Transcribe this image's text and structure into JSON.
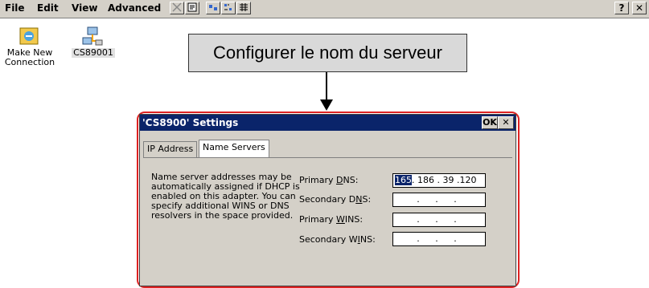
{
  "menubar": {
    "items": [
      "File",
      "Edit",
      "View",
      "Advanced"
    ],
    "help_label": "?",
    "close_label": "✕"
  },
  "desktop": {
    "icons": [
      {
        "label_line1": "Make New",
        "label_line2": "Connection",
        "icon": "make-new-connection-icon"
      },
      {
        "label_line1": "CS89001",
        "label_line2": "",
        "icon": "network-connection-icon"
      }
    ]
  },
  "callout": {
    "text": "Configurer le nom du serveur"
  },
  "dialog": {
    "title": "'CS8900' Settings",
    "ok_label": "OK",
    "close_label": "✕",
    "tabs": [
      "IP Address",
      "Name Servers"
    ],
    "active_tab": "Name Servers",
    "description": "Name server addresses may be automatically assigned if DHCP is enabled on this adapter. You can specify additional WINS or DNS resolvers in the space provided.",
    "fields": [
      {
        "label": "Primary DNS:",
        "value": "165. 186 . 39 .120",
        "selected_part": "165",
        "rest": ". 186 . 39 .120"
      },
      {
        "label": "Secondary DNS:",
        "value": ". . ."
      },
      {
        "label": "Primary WINS:",
        "value": ". . ."
      },
      {
        "label": "Secondary WINS:",
        "value": ". . ."
      }
    ]
  }
}
